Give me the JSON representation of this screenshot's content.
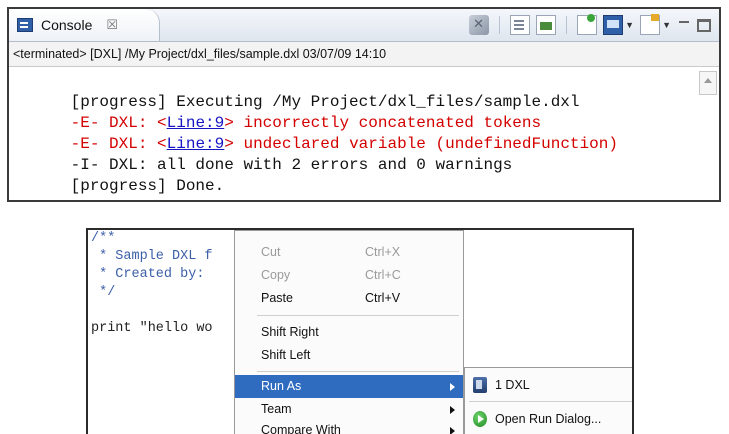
{
  "console": {
    "tab_label": "Console",
    "tab_close": "☒",
    "header": "<terminated> [DXL] /My Project/dxl_files/sample.dxl 03/07/09 14:10",
    "toolbar": {
      "icons": [
        "remove-launch-icon",
        "clear-console-icon",
        "scroll-lock-icon",
        "pin-console-icon",
        "display-console-icon",
        "open-console-icon",
        "minimize-icon",
        "maximize-icon"
      ]
    },
    "lines": [
      {
        "prefix": "[progress] Executing /My Project/dxl_files/sample.dxl",
        "color": "#111111"
      },
      {
        "prefix": "-E- DXL: ",
        "lt": "<",
        "link": "Line:9",
        "gt": ">",
        "rest": " incorrectly concatenated tokens",
        "color": "#d40000"
      },
      {
        "prefix": "-E- DXL: ",
        "lt": "<",
        "link": "Line:9",
        "gt": ">",
        "rest": " undeclared variable (undefinedFunction)",
        "color": "#d40000"
      },
      {
        "prefix": "-I- DXL: all done with 2 errors and 0 warnings",
        "color": "#111111"
      },
      {
        "prefix": "[progress] Done.",
        "color": "#111111"
      }
    ]
  },
  "editor": {
    "code": [
      {
        "text": "/**",
        "kind": "comment"
      },
      {
        "text": " * Sample DXL f",
        "kind": "comment"
      },
      {
        "text": " * Created by:",
        "kind": "comment"
      },
      {
        "text": " */",
        "kind": "comment"
      },
      {
        "text": "",
        "kind": "plain"
      },
      {
        "text": "print \"hello wo",
        "kind": "plain"
      }
    ]
  },
  "context_menu": {
    "items": [
      {
        "label": "Cut",
        "accel": "Ctrl+X",
        "enabled": false
      },
      {
        "label": "Copy",
        "accel": "Ctrl+C",
        "enabled": false
      },
      {
        "label": "Paste",
        "accel": "Ctrl+V",
        "enabled": true
      },
      {
        "label": "Shift Right",
        "accel": "",
        "enabled": true
      },
      {
        "label": "Shift Left",
        "accel": "",
        "enabled": true
      },
      {
        "label": "Run As",
        "accel": "",
        "enabled": true,
        "submenu": true,
        "selected": true
      },
      {
        "label": "Team",
        "accel": "",
        "enabled": true,
        "submenu": true
      },
      {
        "label": "Compare With",
        "accel": "",
        "enabled": true,
        "submenu": true
      }
    ]
  },
  "run_as_submenu": {
    "items": [
      {
        "label": "1 DXL",
        "icon": "dxl-file-icon"
      },
      {
        "label": "Open Run Dialog...",
        "icon": "run-icon"
      }
    ]
  },
  "colors": {
    "error_text": "#d40000",
    "link": "#1515c4",
    "menu_selection": "#2f6cc0",
    "comment": "#3c5fa8"
  }
}
